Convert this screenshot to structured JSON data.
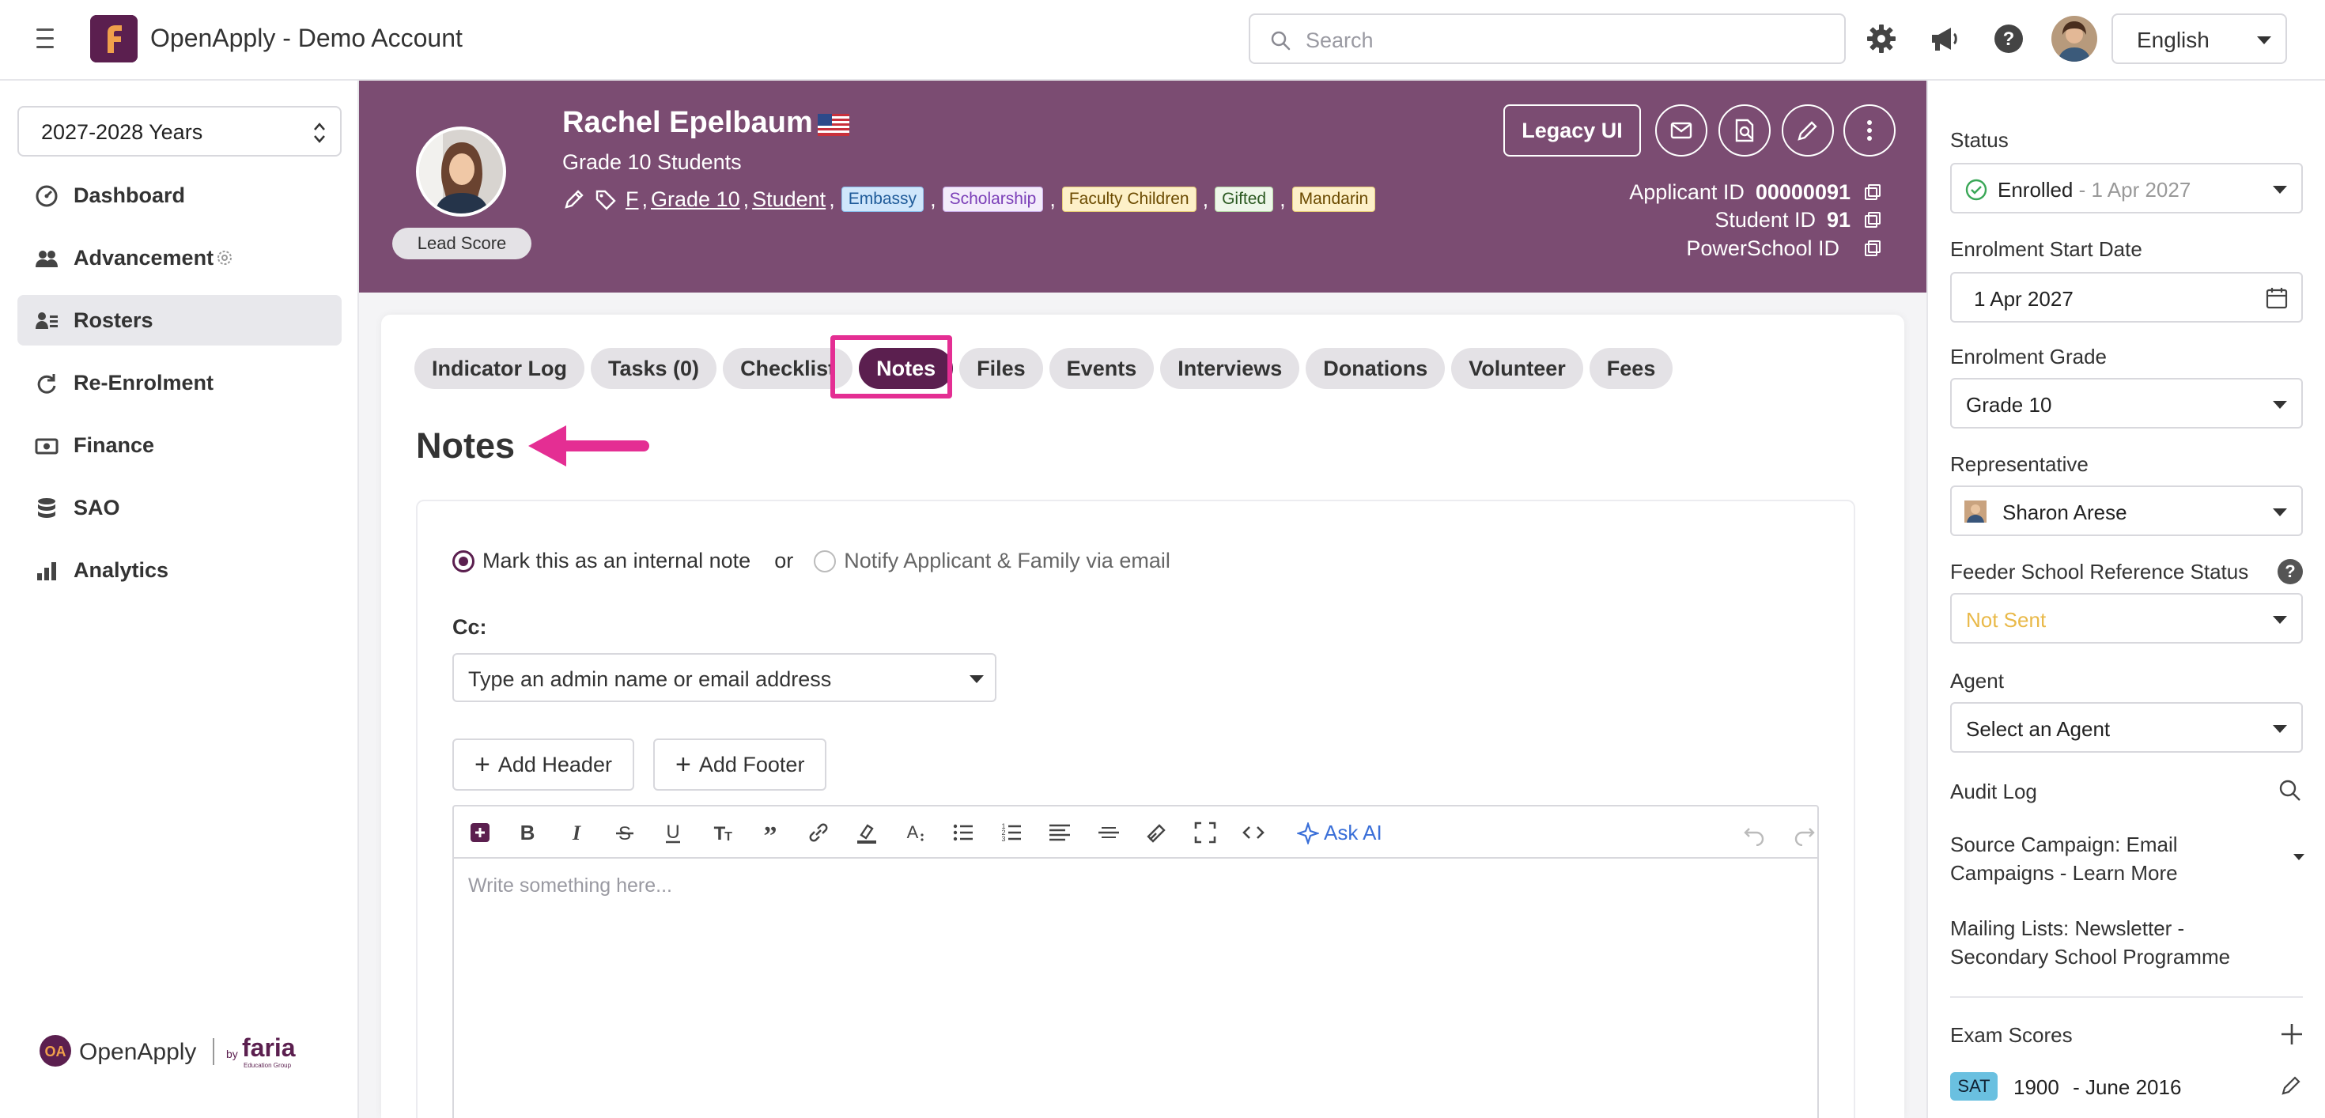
{
  "topbar": {
    "app_title": "OpenApply - Demo Account",
    "search_placeholder": "Search",
    "language": "English"
  },
  "sidebar": {
    "year": "2027-2028 Years",
    "items": [
      {
        "label": "Dashboard",
        "icon": "dashboard-icon",
        "active": false
      },
      {
        "label": "Advancement",
        "icon": "people-icon",
        "active": false
      },
      {
        "label": "Rosters",
        "icon": "roster-icon",
        "active": true
      },
      {
        "label": "Re-Enrolment",
        "icon": "refresh-icon",
        "active": false
      },
      {
        "label": "Finance",
        "icon": "cash-icon",
        "active": false
      },
      {
        "label": "SAO",
        "icon": "database-icon",
        "active": false
      },
      {
        "label": "Analytics",
        "icon": "bar-chart-icon",
        "active": false
      }
    ],
    "logo_text": "OpenApply",
    "logo_by": "by",
    "logo_brand": "faria",
    "logo_sub": "Education Group"
  },
  "profile": {
    "name": "Rachel Epelbaum",
    "grade": "Grade 10 Students",
    "lead_score": "Lead Score",
    "tag_links": [
      "F",
      "Grade 10",
      "Student"
    ],
    "chips": [
      {
        "label": "Embassy",
        "bg": "#cfe6fb",
        "fg": "#1f5b99",
        "border": "#8cc0ee"
      },
      {
        "label": "Scholarship",
        "bg": "#f3ecfb",
        "fg": "#7b3fb8",
        "border": "#cbb0ea"
      },
      {
        "label": "Faculty Children",
        "bg": "#fdf0c8",
        "fg": "#6b4a00",
        "border": "#e9cf7a"
      },
      {
        "label": "Gifted",
        "bg": "#eef7ea",
        "fg": "#2c5a22",
        "border": "#b6d8a8"
      },
      {
        "label": "Mandarin",
        "bg": "#fdf0c8",
        "fg": "#6b4a00",
        "border": "#e9cf7a"
      }
    ],
    "legacy_ui": "Legacy UI",
    "applicant_id_label": "Applicant ID",
    "applicant_id": "00000091",
    "student_id_label": "Student ID",
    "student_id": "91",
    "powerschool_id_label": "PowerSchool ID",
    "powerschool_id": ""
  },
  "tabs": [
    {
      "label": "Indicator Log",
      "active": false
    },
    {
      "label": "Tasks (0)",
      "active": false
    },
    {
      "label": "Checklist",
      "active": false
    },
    {
      "label": "Notes",
      "active": true
    },
    {
      "label": "Files",
      "active": false
    },
    {
      "label": "Events",
      "active": false
    },
    {
      "label": "Interviews",
      "active": false
    },
    {
      "label": "Donations",
      "active": false
    },
    {
      "label": "Volunteer",
      "active": false
    },
    {
      "label": "Fees",
      "active": false
    }
  ],
  "notes": {
    "title": "Notes",
    "radio_internal": "Mark this as an internal note",
    "or": "or",
    "radio_notify": "Notify Applicant & Family via email",
    "cc_label": "Cc:",
    "cc_placeholder": "Type an admin name or email address",
    "add_header": "Add Header",
    "add_footer": "Add Footer",
    "ask_ai": "Ask AI",
    "editor_placeholder": "Write something here..."
  },
  "right_panel": {
    "status_label": "Status",
    "status_value": "Enrolled",
    "status_date": " - 1 Apr 2027",
    "start_date_label": "Enrolment Start Date",
    "start_date": "1 Apr 2027",
    "grade_label": "Enrolment Grade",
    "grade_value": "Grade 10",
    "rep_label": "Representative",
    "rep_value": "Sharon Arese",
    "feeder_label": "Feeder School Reference Status",
    "feeder_value": "Not Sent",
    "agent_label": "Agent",
    "agent_value": "Select an Agent",
    "audit_label": "Audit Log",
    "source_campaign": "Source Campaign: Email Campaigns - Learn More",
    "mailing_lists": "Mailing Lists: Newsletter - Secondary School Programme",
    "exam_label": "Exam Scores",
    "exam_badge": "SAT",
    "exam_score": "1900",
    "exam_date": "- June 2016"
  },
  "colors": {
    "brand": "#5b1f4f",
    "header_bg": "#7b4c72",
    "highlight": "#e42e93",
    "ask_ai": "#3a6fd8",
    "not_sent": "#e9b949",
    "enrolled_check": "#3aa757"
  }
}
